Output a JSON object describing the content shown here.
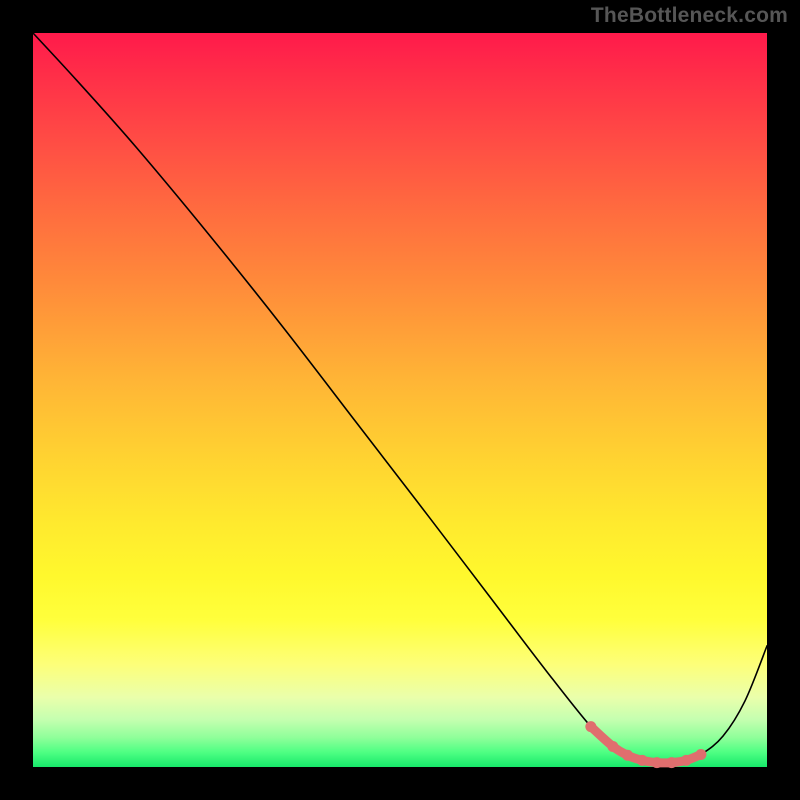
{
  "watermark": "TheBottleneck.com",
  "colors": {
    "optimal_stroke": "#e06e6e",
    "optimal_dot": "#e06e6e",
    "curve_stroke": "#000000"
  },
  "chart_data": {
    "type": "line",
    "title": "",
    "xlabel": "",
    "ylabel": "",
    "xlim": [
      0,
      100
    ],
    "ylim": [
      0,
      100
    ],
    "grid": false,
    "legend": false,
    "series": [
      {
        "name": "bottleneck_curve",
        "x": [
          0,
          6,
          14,
          24,
          34,
          44,
          54,
          62,
          70,
          76,
          79,
          81,
          83,
          85,
          87,
          89,
          91,
          94,
          97,
          100
        ],
        "y": [
          100,
          93.5,
          84.5,
          72.5,
          60,
          47,
          34,
          23.5,
          13,
          5.5,
          2.8,
          1.6,
          0.9,
          0.6,
          0.6,
          0.9,
          1.7,
          4.2,
          9.0,
          16.5
        ]
      }
    ],
    "optimal_range": {
      "x": [
        76,
        79,
        81,
        83,
        85,
        87,
        89,
        91
      ],
      "y": [
        5.5,
        2.8,
        1.6,
        0.9,
        0.6,
        0.6,
        0.9,
        1.7
      ]
    }
  }
}
